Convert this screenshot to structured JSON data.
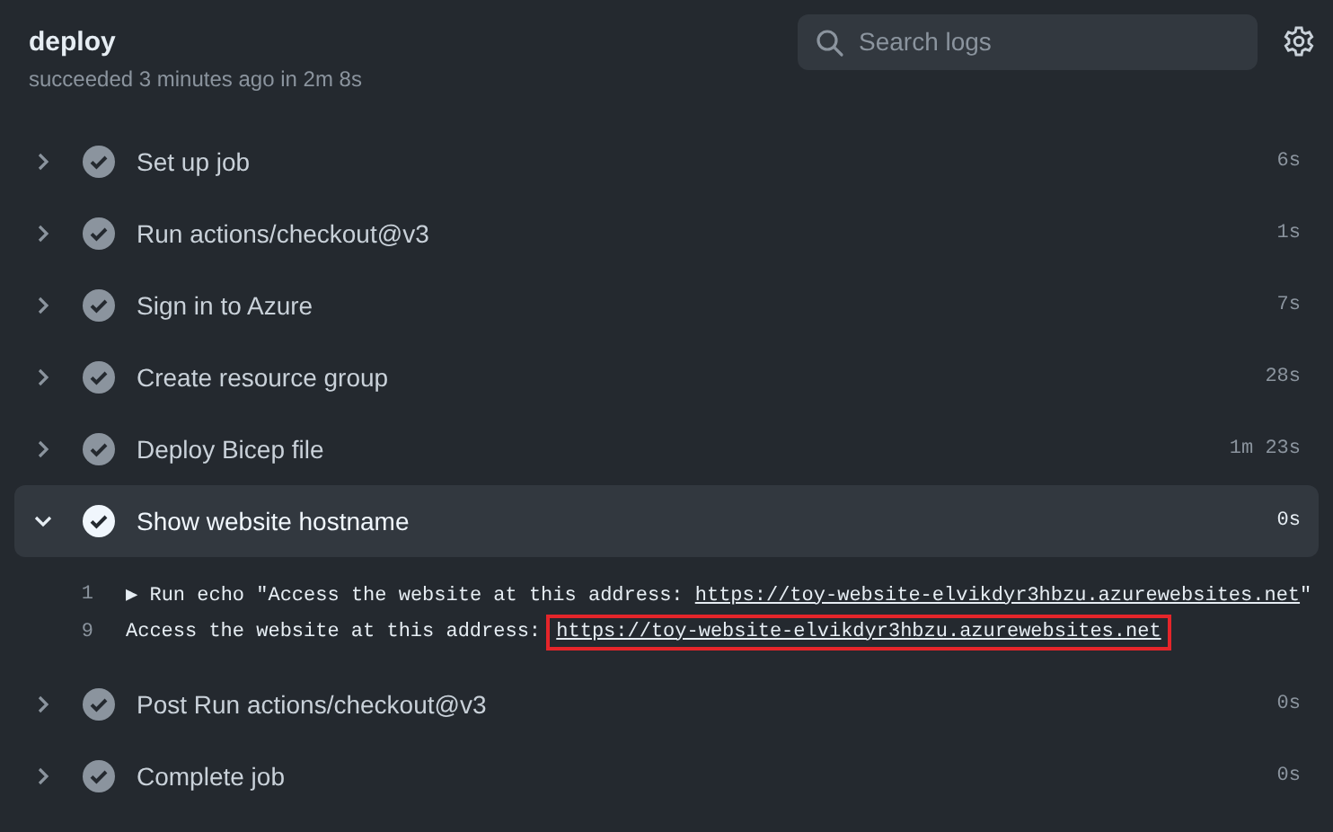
{
  "header": {
    "title": "deploy",
    "subtitle": "succeeded 3 minutes ago in 2m 8s"
  },
  "search": {
    "placeholder": "Search logs"
  },
  "steps": [
    {
      "name": "Set up job",
      "duration": "6s",
      "expanded": false
    },
    {
      "name": "Run actions/checkout@v3",
      "duration": "1s",
      "expanded": false
    },
    {
      "name": "Sign in to Azure",
      "duration": "7s",
      "expanded": false
    },
    {
      "name": "Create resource group",
      "duration": "28s",
      "expanded": false
    },
    {
      "name": "Deploy Bicep file",
      "duration": "1m 23s",
      "expanded": false
    },
    {
      "name": "Show website hostname",
      "duration": "0s",
      "expanded": true,
      "log": [
        {
          "number": "1",
          "prefix": "▶ Run echo \"Access the website at this address: ",
          "link": "https://toy-website-elvikdyr3hbzu.azurewebsites.net",
          "suffix": "\"",
          "highlighted": false
        },
        {
          "number": "9",
          "prefix": "Access the website at this address: ",
          "link": "https://toy-website-elvikdyr3hbzu.azurewebsites.net",
          "highlighted": true
        }
      ]
    },
    {
      "name": "Post Run actions/checkout@v3",
      "duration": "0s",
      "expanded": false
    },
    {
      "name": "Complete job",
      "duration": "0s",
      "expanded": false
    }
  ]
}
